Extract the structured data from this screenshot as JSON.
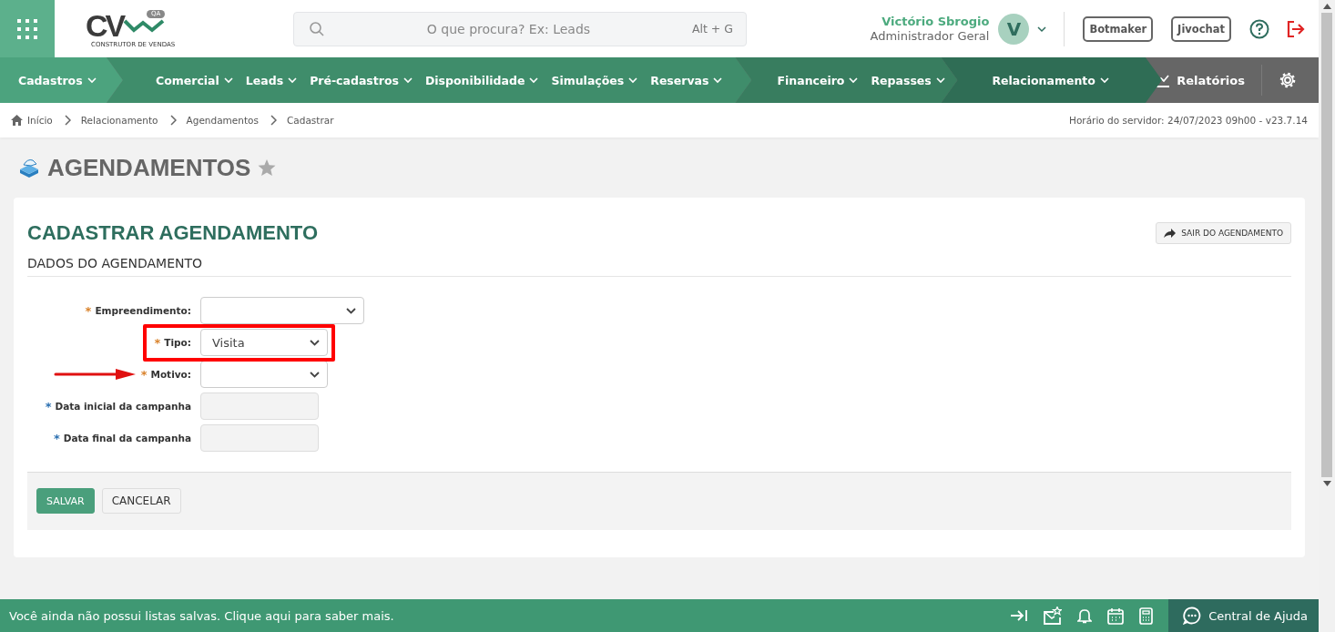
{
  "header": {
    "logo": {
      "letters": "CV",
      "badge": "QA",
      "tagline": "CONSTRUTOR DE VENDAS"
    },
    "search": {
      "placeholder": "O que procura? Ex: Leads",
      "shortcut": "Alt + G"
    },
    "user": {
      "name": "Victório Sbrogio",
      "role": "Administrador Geral",
      "initial": "V"
    },
    "buttons": [
      "Botmaker",
      "Jivochat"
    ]
  },
  "nav": {
    "groups": [
      {
        "color": "#4ca37e",
        "items": [
          "Cadastros"
        ]
      },
      {
        "color": "#3f8d6b",
        "items": [
          "Comercial",
          "Leads",
          "Pré-cadastros",
          "Disponibilidade",
          "Simulações",
          "Reservas"
        ]
      },
      {
        "color": "#387d5f",
        "items": [
          "Financeiro",
          "Repasses"
        ]
      },
      {
        "color": "#2f6d55",
        "items": [
          "Relacionamento"
        ]
      }
    ],
    "right": {
      "reports": "Relatórios"
    }
  },
  "breadcrumb": {
    "items": [
      "Início",
      "Relacionamento",
      "Agendamentos",
      "Cadastrar"
    ],
    "server_time": "Horário do servidor: 24/07/2023 09h00 - v23.7.14"
  },
  "page": {
    "title": "AGENDAMENTOS"
  },
  "card": {
    "title": "CADASTRAR AGENDAMENTO",
    "exit_button": "SAIR DO AGENDAMENTO",
    "section": "DADOS DO AGENDAMENTO",
    "fields": [
      {
        "kind": "select",
        "marker": "*",
        "color": "#d9822b",
        "label": "Empreendimento:",
        "highlighted": false,
        "pointed": false
      },
      {
        "kind": "select",
        "marker": "*",
        "color": "#d9822b",
        "label": "Tipo:",
        "value": "Visita",
        "highlighted": true,
        "pointed": false
      },
      {
        "kind": "select",
        "marker": "*",
        "color": "#d9822b",
        "label": "Motivo:",
        "highlighted": false,
        "pointed": true
      },
      {
        "kind": "date",
        "marker": "*",
        "color": "#2a6fb0",
        "label": "Data inicial da campanha",
        "highlighted": false,
        "pointed": false
      },
      {
        "kind": "date",
        "marker": "*",
        "color": "#2a6fb0",
        "label": "Data final da campanha",
        "highlighted": false,
        "pointed": false
      }
    ],
    "actions": [
      {
        "label": "SALVAR",
        "kind": "primary"
      },
      {
        "label": "CANCELAR",
        "kind": "secondary"
      }
    ]
  },
  "footer": {
    "message": "Você ainda não possui listas salvas. Clique aqui para saber mais.",
    "help": "Central de Ajuda"
  }
}
